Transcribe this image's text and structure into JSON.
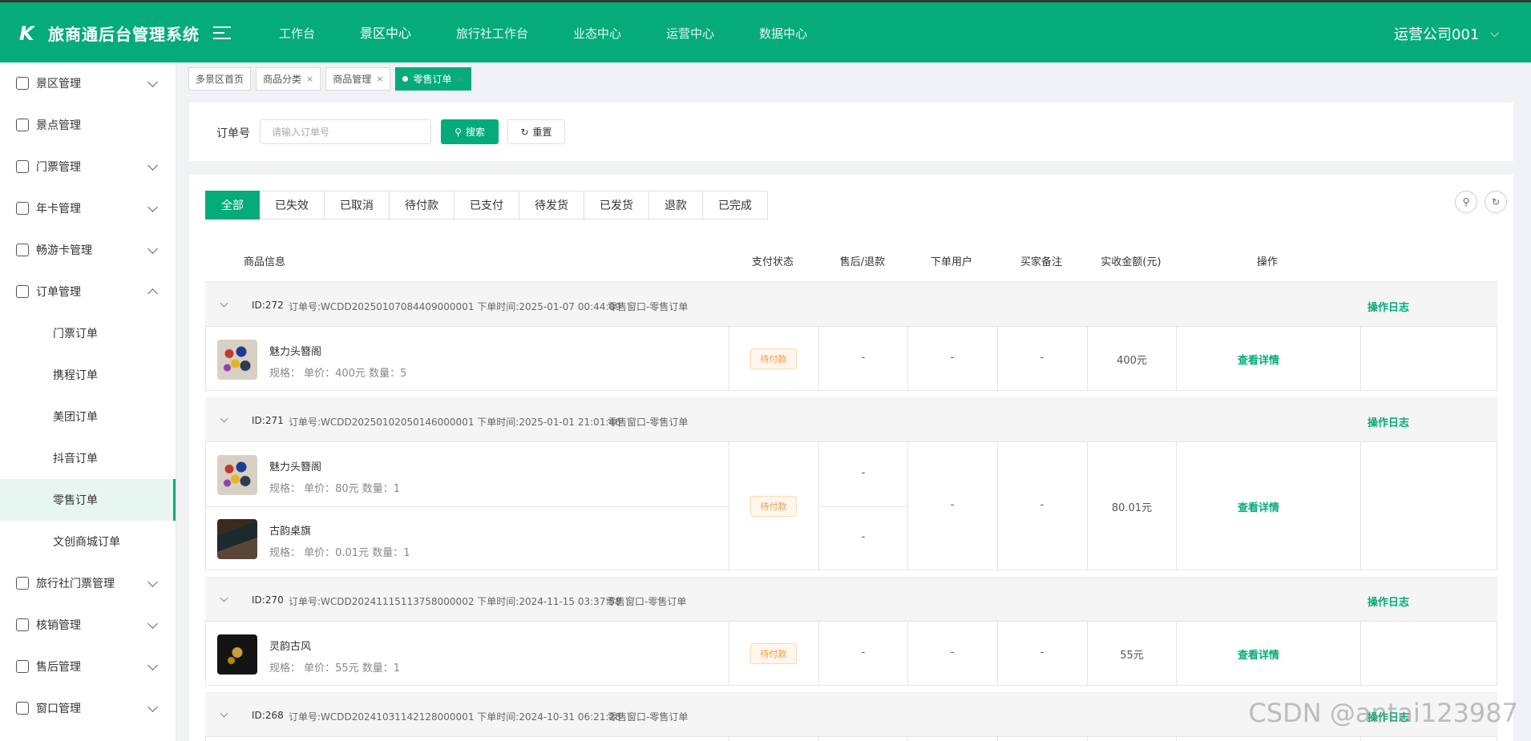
{
  "header": {
    "brand_logo": "K",
    "title": "旅商通后台管理系统",
    "nav": [
      "工作台",
      "景区中心",
      "旅行社工作台",
      "业态中心",
      "运营中心",
      "数据中心"
    ],
    "nav_active": "景区中心",
    "user": "运营公司001"
  },
  "sidebar": {
    "items": [
      {
        "label": "景区管理",
        "icon": "scenic-icon",
        "expandable": true
      },
      {
        "label": "景点管理",
        "icon": "spot-icon",
        "expandable": false
      },
      {
        "label": "门票管理",
        "icon": "ticket-icon",
        "expandable": true
      },
      {
        "label": "年卡管理",
        "icon": "card-icon",
        "expandable": true
      },
      {
        "label": "畅游卡管理",
        "icon": "copy-icon",
        "expandable": true
      },
      {
        "label": "订单管理",
        "icon": "list-icon",
        "expandable": true,
        "expanded": true
      }
    ],
    "sub_items": [
      "门票订单",
      "携程订单",
      "美团订单",
      "抖音订单",
      "零售订单",
      "文创商城订单"
    ],
    "sub_active": "零售订单",
    "items_after": [
      {
        "label": "旅行社门票管理",
        "icon": "agency-icon"
      },
      {
        "label": "核销管理",
        "icon": "verify-icon"
      },
      {
        "label": "售后管理",
        "icon": "aftersale-icon"
      },
      {
        "label": "窗口管理",
        "icon": "window-icon"
      }
    ]
  },
  "tabs": [
    {
      "label": "多景区首页",
      "closable": false,
      "active": false
    },
    {
      "label": "商品分类",
      "closable": true,
      "active": false
    },
    {
      "label": "商品管理",
      "closable": true,
      "active": false
    },
    {
      "label": "零售订单",
      "closable": true,
      "active": true
    }
  ],
  "search": {
    "label": "订单号",
    "placeholder": "请输入订单号",
    "search_btn": "搜索",
    "reset_btn": "重置"
  },
  "status_tabs": [
    "全部",
    "已失效",
    "已取消",
    "待付款",
    "已支付",
    "待发货",
    "已发货",
    "退款",
    "已完成"
  ],
  "status_active": "全部",
  "table": {
    "columns": [
      "商品信息",
      "支付状态",
      "售后/退款",
      "下单用户",
      "买家备注",
      "实收金额(元)",
      "操作"
    ]
  },
  "orders": [
    {
      "id": "ID:272",
      "info": "订单号:WCDD20250107084409000001 下单时间:2025-01-07 00:44:09",
      "source": "零售窗口-零售订单",
      "log": "操作日志",
      "items": [
        {
          "name": "魅力头簪阁",
          "spec": "规格：   单价：400元   数量：5",
          "img": "hairpin"
        }
      ],
      "pay_status": "待付款",
      "refunds": [
        "-"
      ],
      "user": "-",
      "remark": "-",
      "amount": "400元",
      "detail": "查看详情"
    },
    {
      "id": "ID:271",
      "info": "订单号:WCDD20250102050146000001 下单时间:2025-01-01 21:01:46",
      "source": "零售窗口-零售订单",
      "log": "操作日志",
      "items": [
        {
          "name": "魅力头簪阁",
          "spec": "规格：   单价：80元   数量：1",
          "img": "hairpin"
        },
        {
          "name": "古韵桌旗",
          "spec": "规格：   单价：0.01元   数量：1",
          "img": "tableflag"
        }
      ],
      "pay_status": "待付款",
      "refunds": [
        "-",
        "-"
      ],
      "user": "-",
      "remark": "-",
      "amount": "80.01元",
      "detail": "查看详情"
    },
    {
      "id": "ID:270",
      "info": "订单号:WCDD20241115113758000002 下单时间:2024-11-15 03:37:58",
      "source": "零售窗口-零售订单",
      "log": "操作日志",
      "items": [
        {
          "name": "灵韵古风",
          "spec": "规格：   单价：55元   数量：1",
          "img": "pendant"
        }
      ],
      "pay_status": "待付款",
      "refunds": [
        "-"
      ],
      "user": "-",
      "remark": "-",
      "amount": "55元",
      "detail": "查看详情"
    },
    {
      "id": "ID:268",
      "info": "订单号:WCDD20241031142128000001 下单时间:2024-10-31 06:21:28",
      "source": "零售窗口-零售订单",
      "log": "操作日志",
      "items": [],
      "pay_status": "",
      "refunds": [],
      "user": "",
      "remark": "",
      "amount": "",
      "detail": ""
    }
  ],
  "watermark": "CSDN @antai123987",
  "colors": {
    "primary": "#05ab79",
    "pending_text": "#f09b4a",
    "pending_bg": "#fff6ec"
  }
}
